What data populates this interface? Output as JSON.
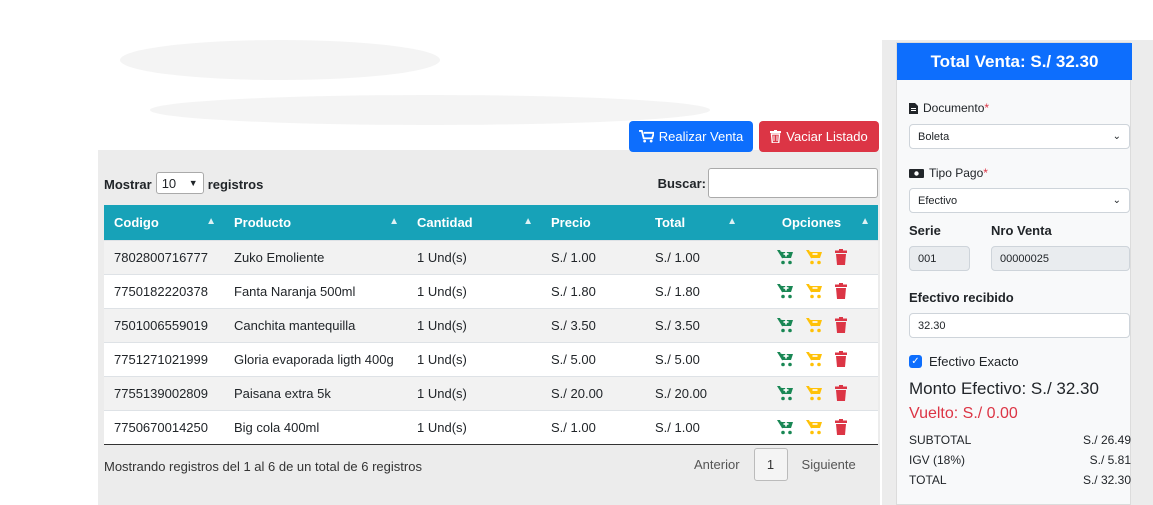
{
  "toolbar": {
    "realizar_label": "Realizar Venta",
    "vaciar_label": "Vaciar Listado"
  },
  "table_controls": {
    "show_prefix": "Mostrar",
    "page_size": "10",
    "show_suffix": "registros",
    "search_label": "Buscar:",
    "search_value": ""
  },
  "columns": [
    "Codigo",
    "Producto",
    "Cantidad",
    "Precio",
    "Total",
    "Opciones"
  ],
  "rows": [
    {
      "codigo": "7802800716777",
      "producto": "Zuko Emoliente",
      "cantidad": "1 Und(s)",
      "precio": "S./ 1.00",
      "total": "S./ 1.00"
    },
    {
      "codigo": "7750182220378",
      "producto": "Fanta Naranja 500ml",
      "cantidad": "1 Und(s)",
      "precio": "S./ 1.80",
      "total": "S./ 1.80"
    },
    {
      "codigo": "7501006559019",
      "producto": "Canchita mantequilla",
      "cantidad": "1 Und(s)",
      "precio": "S./ 3.50",
      "total": "S./ 3.50"
    },
    {
      "codigo": "7751271021999",
      "producto": "Gloria evaporada ligth 400g",
      "cantidad": "1 Und(s)",
      "precio": "S./ 5.00",
      "total": "S./ 5.00"
    },
    {
      "codigo": "7755139002809",
      "producto": "Paisana extra 5k",
      "cantidad": "1 Und(s)",
      "precio": "S./ 20.00",
      "total": "S./ 20.00"
    },
    {
      "codigo": "7750670014250",
      "producto": "Big cola 400ml",
      "cantidad": "1 Und(s)",
      "precio": "S./ 1.00",
      "total": "S./ 1.00"
    }
  ],
  "footer": {
    "info": "Mostrando registros del 1 al 6 de un total de 6 registros",
    "prev": "Anterior",
    "page": "1",
    "next": "Siguiente"
  },
  "sidebar": {
    "total_venta": "Total Venta: S./ 32.30",
    "documento_label": "Documento",
    "documento_value": "Boleta",
    "tipo_pago_label": "Tipo Pago",
    "tipo_pago_value": "Efectivo",
    "serie_label": "Serie",
    "serie_value": "001",
    "nro_venta_label": "Nro Venta",
    "nro_venta_value": "00000025",
    "efectivo_recibido_label": "Efectivo recibido",
    "efectivo_recibido_value": "32.30",
    "efectivo_exacto_label": "Efectivo Exacto",
    "efectivo_exacto_checked": true,
    "monto_efectivo": "Monto Efectivo: S./ 32.30",
    "vuelto": "Vuelto: S./ 0.00",
    "subtotal_label": "SUBTOTAL",
    "subtotal_value": "S./ 26.49",
    "igv_label": "IGV (18%)",
    "igv_value": "S./ 5.81",
    "total_label": "TOTAL",
    "total_value": "S./ 32.30"
  },
  "colors": {
    "primary": "#0d6efd",
    "danger": "#dc3545",
    "header_teal": "#17a2b8",
    "cart_green": "#198754",
    "cart_yellow": "#ffc107"
  },
  "icons": [
    "shopping-cart-icon",
    "trash-icon",
    "file-icon",
    "money-bill-icon",
    "cart-plus-icon",
    "cart-minus-icon",
    "chevron-down-icon",
    "check-icon"
  ]
}
